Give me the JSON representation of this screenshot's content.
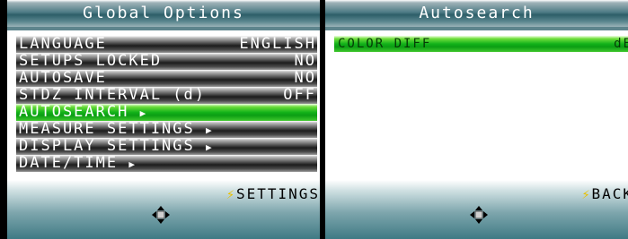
{
  "left": {
    "title": "Global Options",
    "rows": [
      {
        "label": "LANGUAGE",
        "value": "ENGLISH"
      },
      {
        "label": "SETUPS LOCKED",
        "value": "NO"
      },
      {
        "label": "AUTOSAVE",
        "value": "NO"
      },
      {
        "label": "STDZ INTERVAL (d)",
        "value": "OFF"
      },
      {
        "label": "AUTOSEARCH",
        "arrow": "▶",
        "selected": true
      },
      {
        "label": "MEASURE SETTINGS",
        "arrow": "▶"
      },
      {
        "label": "DISPLAY SETTINGS",
        "arrow": "▶"
      },
      {
        "label": "DATE/TIME",
        "arrow": "▶"
      }
    ],
    "softkey": {
      "icon": "lightning-bolt-icon",
      "label": "SETTINGS"
    }
  },
  "right": {
    "title": "Autosearch",
    "rows": [
      {
        "label": "COLOR DIFF",
        "value": "dE"
      }
    ],
    "softkey": {
      "icon": "lightning-bolt-icon",
      "label": "BACK"
    }
  },
  "colors": {
    "selected_green": "#12b21a",
    "title_teal": "#2d5e68",
    "bolt_yellow": "#e8c000"
  },
  "icons": [
    "lightning-bolt-icon",
    "dpad-icon",
    "right-arrow-icon"
  ]
}
